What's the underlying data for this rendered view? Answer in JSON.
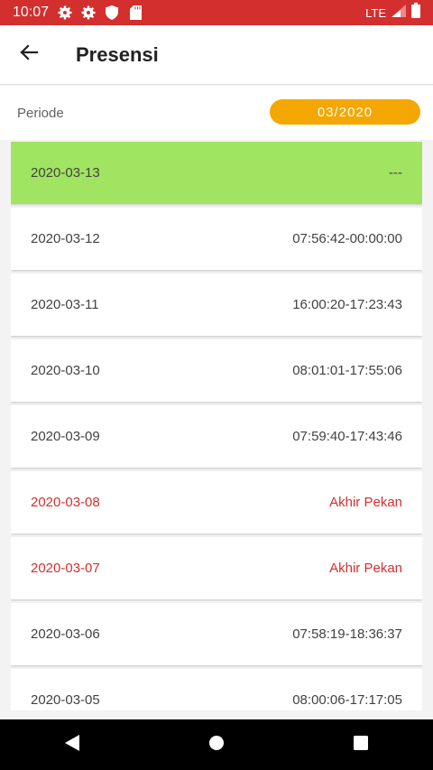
{
  "status_bar": {
    "time": "10:07",
    "network": "LTE"
  },
  "app_bar": {
    "title": "Presensi"
  },
  "periode": {
    "label": "Periode",
    "value": "03/2020"
  },
  "rows": [
    {
      "date": "2020-03-13",
      "value": "---"
    },
    {
      "date": "2020-03-12",
      "value": "07:56:42-00:00:00"
    },
    {
      "date": "2020-03-11",
      "value": "16:00:20-17:23:43"
    },
    {
      "date": "2020-03-10",
      "value": "08:01:01-17:55:06"
    },
    {
      "date": "2020-03-09",
      "value": "07:59:40-17:43:46"
    },
    {
      "date": "2020-03-08",
      "value": "Akhir Pekan"
    },
    {
      "date": "2020-03-07",
      "value": "Akhir Pekan"
    },
    {
      "date": "2020-03-06",
      "value": "07:58:19-18:36:37"
    },
    {
      "date": "2020-03-05",
      "value": "08:00:06-17:17:05"
    }
  ],
  "colors": {
    "status_bar": "#d32f2f",
    "today_row": "#a1e461",
    "periode_pill": "#f4a700",
    "weekend_text": "#d32f2f"
  },
  "icons": {
    "status_left": [
      "gear-icon",
      "gear-icon",
      "shield-icon",
      "sd-card-icon"
    ],
    "status_right": [
      "signal-icon",
      "battery-icon"
    ],
    "app_bar": "arrow-back-icon",
    "nav": [
      "nav-back-icon",
      "nav-home-icon",
      "nav-recents-icon"
    ]
  }
}
